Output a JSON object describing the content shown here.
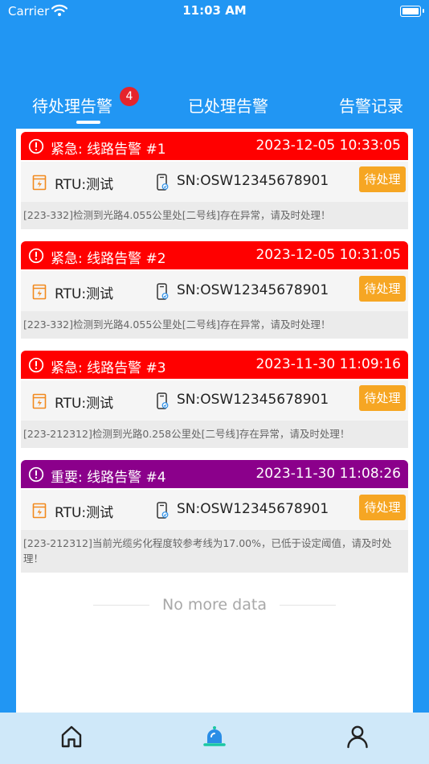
{
  "status_bar": {
    "carrier": "Carrier",
    "time": "11:03 AM"
  },
  "tabs": {
    "pending": "待处理告警",
    "pending_count": "4",
    "processed": "已处理告警",
    "history": "告警记录"
  },
  "alarms": [
    {
      "title": "紧急: 线路告警 #1",
      "time": "2023-12-05 10:33:05",
      "rtu": "RTU:测试",
      "sn": "SN:OSW12345678901",
      "status": "待处理",
      "message": "[223-332]检测到光路4.055公里处[二号线]存在异常，请及时处理！",
      "color": "#FF0000"
    },
    {
      "title": "紧急: 线路告警 #2",
      "time": "2023-12-05 10:31:05",
      "rtu": "RTU:测试",
      "sn": "SN:OSW12345678901",
      "status": "待处理",
      "message": "[223-332]检测到光路4.055公里处[二号线]存在异常，请及时处理！",
      "color": "#FF0000"
    },
    {
      "title": "紧急: 线路告警 #3",
      "time": "2023-11-30 11:09:16",
      "rtu": "RTU:测试",
      "sn": "SN:OSW12345678901",
      "status": "待处理",
      "message": "[223-212312]检测到光路0.258公里处[二号线]存在异常，请及时处理！",
      "color": "#FF0000"
    },
    {
      "title": "重要: 线路告警 #4",
      "time": "2023-11-30 11:08:26",
      "rtu": "RTU:测试",
      "sn": "SN:OSW12345678901",
      "status": "待处理",
      "message": "[223-212312]当前光缆劣化程度较参考线为17.00%，已低于设定阈值，请及时处理！",
      "color": "#8B008B"
    }
  ],
  "list_footer": "No more data",
  "tabbar": {
    "home_icon": "home-icon",
    "alarm_icon": "bell-icon",
    "profile_icon": "person-icon"
  }
}
